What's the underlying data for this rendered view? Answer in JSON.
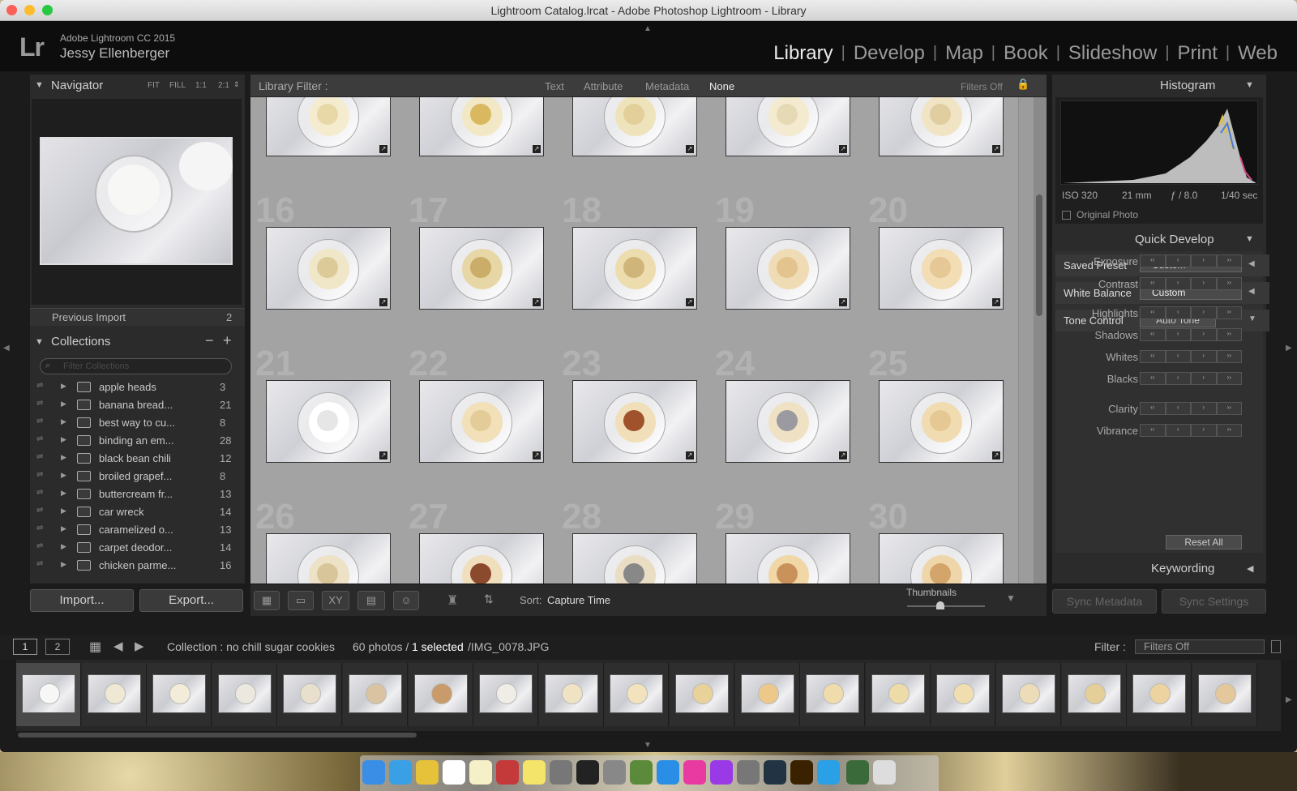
{
  "window": {
    "title": "Lightroom Catalog.lrcat - Adobe Photoshop Lightroom - Library"
  },
  "identity": {
    "logo": "Lr",
    "app": "Adobe Lightroom CC 2015",
    "user": "Jessy Ellenberger"
  },
  "modules": [
    "Library",
    "Develop",
    "Map",
    "Book",
    "Slideshow",
    "Print",
    "Web"
  ],
  "navigator": {
    "title": "Navigator",
    "zoom": [
      "FIT",
      "FILL",
      "1:1",
      "2:1"
    ]
  },
  "catalog": {
    "previous_import": "Previous Import",
    "previous_import_count": "2"
  },
  "collections": {
    "title": "Collections",
    "filter_placeholder": "Filter Collections",
    "items": [
      {
        "name": "apple heads",
        "count": "3"
      },
      {
        "name": "banana bread...",
        "count": "21"
      },
      {
        "name": "best way to cu...",
        "count": "8"
      },
      {
        "name": "binding an em...",
        "count": "28"
      },
      {
        "name": "black bean chili",
        "count": "12"
      },
      {
        "name": "broiled grapef...",
        "count": "8"
      },
      {
        "name": "buttercream fr...",
        "count": "13"
      },
      {
        "name": "car wreck",
        "count": "14"
      },
      {
        "name": "caramelized o...",
        "count": "13"
      },
      {
        "name": "carpet deodor...",
        "count": "14"
      },
      {
        "name": "chicken parme...",
        "count": "16"
      }
    ]
  },
  "left_buttons": {
    "import": "Import...",
    "export": "Export..."
  },
  "filter_bar": {
    "label": "Library Filter :",
    "tabs": [
      "Text",
      "Attribute",
      "Metadata",
      "None"
    ],
    "filters_off": "Filters Off"
  },
  "grid": {
    "row_numbers": [
      "16",
      "17",
      "18",
      "19",
      "20",
      "21",
      "22",
      "23",
      "24",
      "25",
      "26",
      "27",
      "28",
      "29",
      "30"
    ]
  },
  "toolbar": {
    "sort_label": "Sort:",
    "sort_value": "Capture Time",
    "thumbnails_label": "Thumbnails"
  },
  "histogram": {
    "title": "Histogram",
    "iso": "ISO 320",
    "focal": "21 mm",
    "aperture": "ƒ / 8.0",
    "shutter": "1/40 sec",
    "original_photo": "Original Photo"
  },
  "quick_develop": {
    "title": "Quick Develop",
    "saved_preset_label": "Saved Preset",
    "saved_preset_value": "Custom",
    "white_balance_label": "White Balance",
    "white_balance_value": "Custom",
    "tone_control_label": "Tone Control",
    "auto_tone": "Auto Tone",
    "sliders": [
      "Exposure",
      "Contrast",
      "Highlights",
      "Shadows",
      "Whites",
      "Blacks",
      "Clarity",
      "Vibrance"
    ],
    "reset_all": "Reset All"
  },
  "keywording": {
    "title": "Keywording"
  },
  "sync": {
    "metadata": "Sync Metadata",
    "settings": "Sync Settings"
  },
  "filmstrip": {
    "screens": [
      "1",
      "2"
    ],
    "collection": "Collection : no chill sugar cookies",
    "photos_count": "60 photos /",
    "selected": "1 selected",
    "file": "/IMG_0078.JPG",
    "filter_label": "Filter :",
    "filter_value": "Filters Off"
  }
}
